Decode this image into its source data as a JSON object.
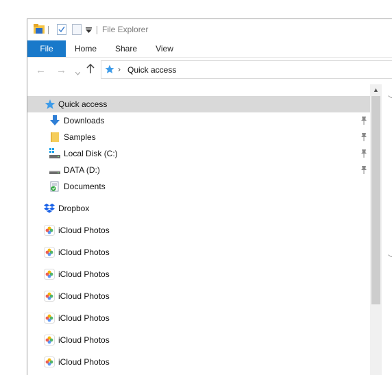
{
  "window": {
    "title": "File Explorer"
  },
  "ribbon": {
    "tabs": [
      "File",
      "Home",
      "Share",
      "View"
    ]
  },
  "address": {
    "crumb": "Quick access",
    "separator": "›"
  },
  "nav": {
    "quick_access": "Quick access",
    "pinned": [
      {
        "label": "Downloads",
        "icon": "download-arrow-icon"
      },
      {
        "label": "Samples",
        "icon": "folder-icon"
      },
      {
        "label": "Local Disk (C:)",
        "icon": "windows-drive-icon"
      },
      {
        "label": "DATA (D:)",
        "icon": "drive-icon"
      },
      {
        "label": "Documents",
        "icon": "documents-icon"
      }
    ],
    "dropbox": "Dropbox",
    "icloud": [
      "iCloud Photos",
      "iCloud Photos",
      "iCloud Photos",
      "iCloud Photos",
      "iCloud Photos",
      "iCloud Photos",
      "iCloud Photos"
    ]
  },
  "colors": {
    "accent": "#1979ca",
    "selected_bg": "#d9d9d9",
    "folder": "#f5cd5b",
    "dropbox": "#1a62e8"
  }
}
